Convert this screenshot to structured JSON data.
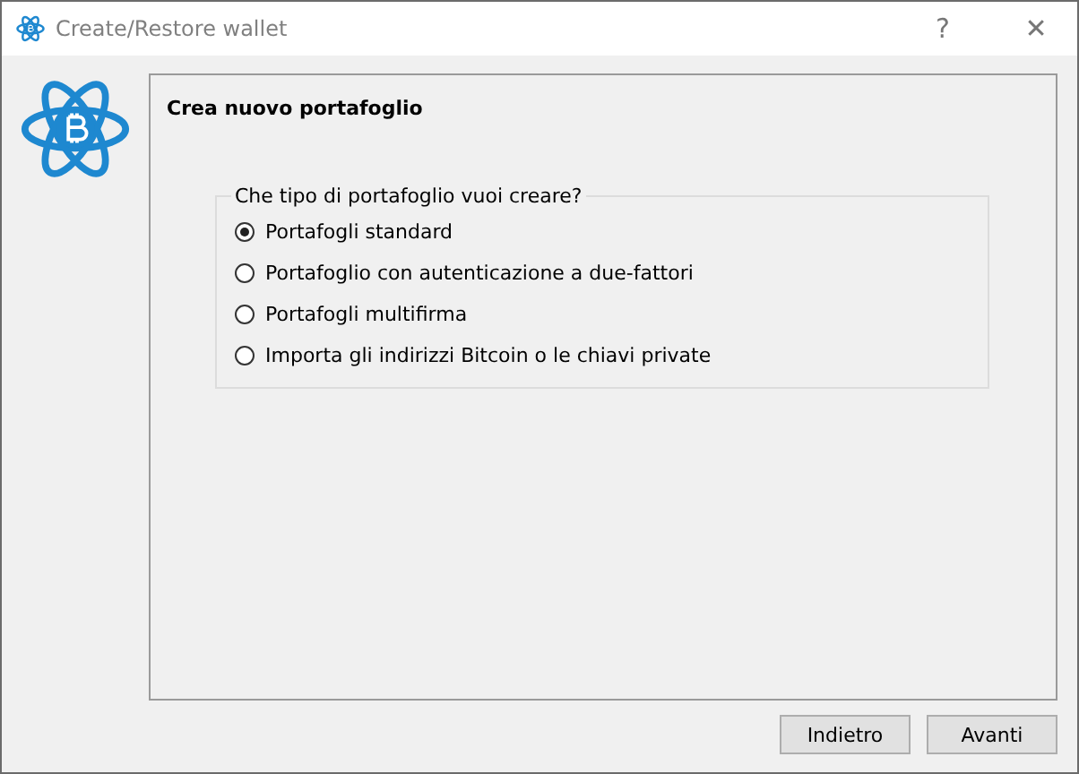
{
  "window": {
    "title": "Create/Restore wallet",
    "controls": [
      "?",
      "✕"
    ]
  },
  "panel": {
    "title": "Crea nuovo portafoglio",
    "group": {
      "title": "Che tipo di portafoglio vuoi creare?",
      "options": [
        {
          "label": "Portafogli standard",
          "selected": true
        },
        {
          "label": "Portafoglio con autenticazione a due-fattori",
          "selected": false
        },
        {
          "label": "Portafogli multifirma",
          "selected": false
        },
        {
          "label": "Importa gli indirizzi Bitcoin o le chiavi private",
          "selected": false
        }
      ]
    }
  },
  "buttons": [
    "Indietro",
    "Avanti"
  ]
}
